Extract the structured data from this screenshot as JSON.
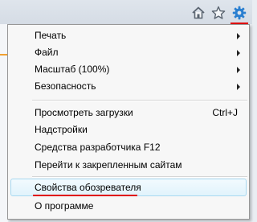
{
  "toolbar": {
    "icons": [
      "home-icon",
      "star-icon",
      "gear-icon"
    ]
  },
  "menu": {
    "items": [
      {
        "label": "Печать",
        "has_submenu": true
      },
      {
        "label": "Файл",
        "has_submenu": true
      },
      {
        "label": "Масштаб (100%)",
        "has_submenu": true
      },
      {
        "label": "Безопасность",
        "has_submenu": true
      },
      {
        "label": "Просмотреть загрузки",
        "shortcut": "Ctrl+J"
      },
      {
        "label": "Надстройки"
      },
      {
        "label": "Средства разработчика F12"
      },
      {
        "label": "Перейти к закрепленным сайтам"
      },
      {
        "label": "Свойства обозревателя",
        "highlighted": true
      },
      {
        "label": "О программе"
      }
    ]
  },
  "colors": {
    "annotation_red": "#e00000",
    "gear_blue": "#2a7fd0",
    "highlight_border": "#a8d8f0"
  }
}
